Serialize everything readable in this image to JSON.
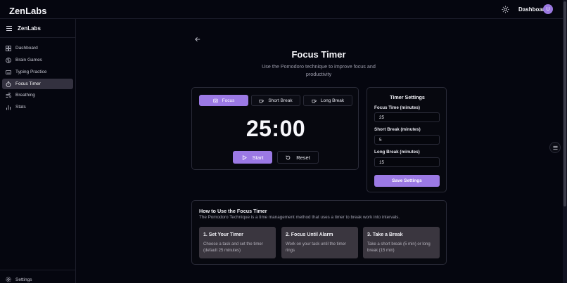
{
  "app": {
    "brand": "ZenLabs"
  },
  "topbar": {
    "dashboard_link": "Dashboard",
    "avatar_initial": "U"
  },
  "sidebar": {
    "brand": "ZenLabs",
    "items": [
      {
        "label": "Dashboard",
        "icon": "grid-icon"
      },
      {
        "label": "Brain Games",
        "icon": "brain-icon"
      },
      {
        "label": "Typing Practice",
        "icon": "keyboard-icon"
      },
      {
        "label": "Focus Timer",
        "icon": "timer-icon",
        "active": true
      },
      {
        "label": "Breathing",
        "icon": "wind-icon"
      },
      {
        "label": "Stats",
        "icon": "bar-chart-icon"
      }
    ],
    "settings_label": "Settings"
  },
  "page": {
    "title": "Focus Timer",
    "subtitle_line1": "Use the Pomodoro technique to improve focus and",
    "subtitle_line2": "productivity"
  },
  "timer": {
    "modes": [
      "Focus",
      "Short Break",
      "Long Break"
    ],
    "active_mode": "Focus",
    "display": "25:00",
    "start_label": "Start",
    "reset_label": "Reset"
  },
  "settings": {
    "title": "Timer Settings",
    "focus_label": "Focus Time (minutes)",
    "focus_value": "25",
    "short_label": "Short Break (minutes)",
    "short_value": "5",
    "long_label": "Long Break (minutes)",
    "long_value": "15",
    "save_label": "Save Settings"
  },
  "howto": {
    "title": "How to Use the Focus Timer",
    "subtitle": "The Pomodoro Technique is a time management method that uses a timer to break work into intervals.",
    "steps": [
      {
        "title": "1. Set Your Timer",
        "desc": "Choose a task and set the timer (default 25 minutes)"
      },
      {
        "title": "2. Focus Until Alarm",
        "desc": "Work on your task until the timer rings"
      },
      {
        "title": "3. Take a Break",
        "desc": "Take a short break (5 min) or long break (15 min)"
      }
    ]
  },
  "colors": {
    "accent": "#9b79e4",
    "background": "#05060f",
    "card_border": "#2a2b38",
    "step_bg": "#3a363f"
  }
}
